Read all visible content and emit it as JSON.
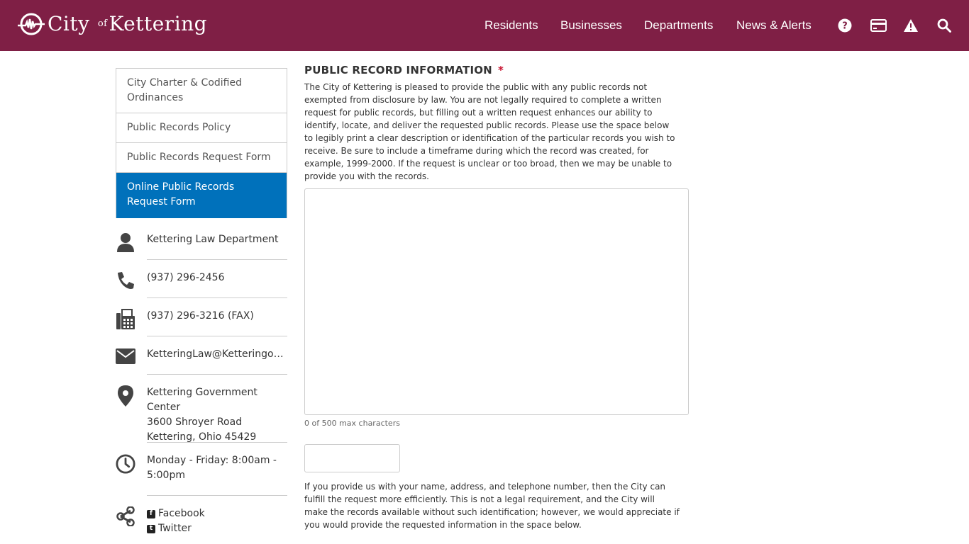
{
  "header": {
    "logo": {
      "city": "City",
      "of": "of",
      "name": "Kettering"
    },
    "nav": [
      "Residents",
      "Businesses",
      "Departments",
      "News & Alerts"
    ],
    "icons": [
      "help-icon",
      "payment-card-icon",
      "alert-icon",
      "search-icon"
    ],
    "bg_color": "#7f1f45"
  },
  "sidenav": {
    "items": [
      {
        "label": "City Charter & Codified Ordinances",
        "active": false
      },
      {
        "label": "Public Records Policy",
        "active": false
      },
      {
        "label": "Public Records Request Form",
        "active": false
      },
      {
        "label": "Online Public Records Request Form",
        "active": true
      }
    ],
    "active_color": "#0071bb"
  },
  "contact": {
    "department": "Kettering Law Department",
    "phone": "(937) 296-2456",
    "fax": "(937) 296-3216 (FAX)",
    "email": "KetteringLaw@Ketteringoh.o...",
    "address": [
      "Kettering Government Center",
      "3600 Shroyer Road",
      "Kettering, Ohio 45429"
    ],
    "hours": [
      "Monday - Friday: 8:00am -",
      "5:00pm"
    ],
    "social": [
      "Facebook",
      "Twitter"
    ]
  },
  "form": {
    "section_title": "PUBLIC RECORD INFORMATION",
    "required_mark": "*",
    "description": "The City of Kettering is pleased to provide the public with any public records not exempted from disclosure by law. You are not legally required to complete a written request for public records, but filling out a written request enhances our ability to identify, locate, and deliver the requested public records. Please use the space below to legibly print a clear description or identification of the particular records you wish to receive. Be sure to include a timeframe during which the record was created, for example, 1999-2000. If the request is unclear or too broad, then we may be unable to provide you with the records.",
    "textarea_value": "",
    "char_counter": "0 of 500 max characters",
    "small_input_value": "",
    "identification_note": "If you provide us with your name, address, and telephone number, then the City can fulfill the request more efficiently. This is not a legal requirement, and the City will make the records available without such identification; however, we would appreciate if you would provide the requested information in the space below."
  }
}
